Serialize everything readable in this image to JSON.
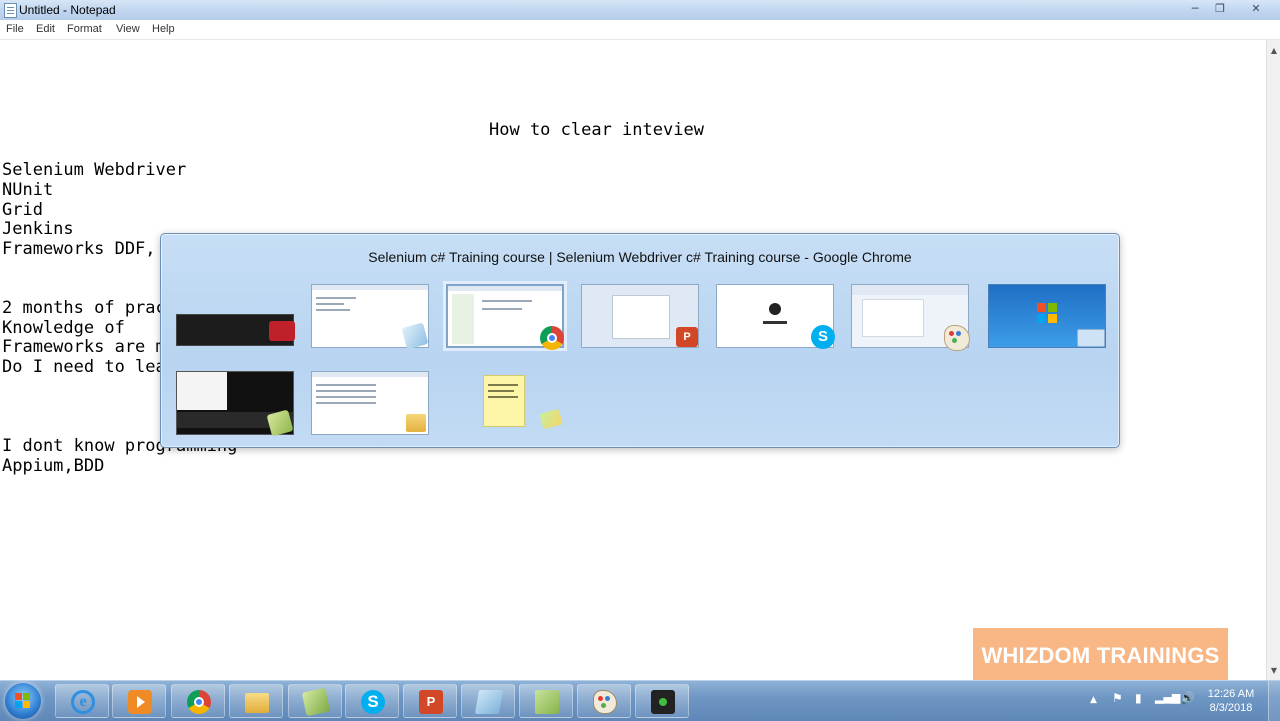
{
  "window": {
    "title": "Untitled - Notepad",
    "minimize": "─",
    "maximize": "❐",
    "close": "✕"
  },
  "menu": [
    "File",
    "Edit",
    "Format",
    "View",
    "Help"
  ],
  "document": {
    "heading": "How to clear inteview",
    "lines": [
      "Selenium Webdriver",
      "NUnit",
      "Grid",
      "Jenkins",
      "Frameworks DDF, POM, Hybrid  BDD(Specflow)",
      "",
      "",
      "2 months of practice",
      "Knowledge of",
      "Frameworks are most",
      "Do I need to learn all types of frameworks",
      "",
      "",
      "",
      "I dont know programming",
      "Appium,BDD"
    ]
  },
  "switcher": {
    "title": "Selenium c# Training course | Selenium Webdriver c# Training course - Google Chrome",
    "items": [
      {
        "app": "screen-recorder",
        "badge": "tape-icon"
      },
      {
        "app": "notepad",
        "badge": "notepad-icon"
      },
      {
        "app": "google-chrome",
        "badge": "chrome-icon",
        "selected": true
      },
      {
        "app": "powerpoint",
        "badge": "powerpoint-icon",
        "badge_text": "P"
      },
      {
        "app": "skype",
        "badge": "skype-icon",
        "badge_text": "S"
      },
      {
        "app": "paint",
        "badge": "paint-icon"
      },
      {
        "app": "desktop",
        "badge": "desktop-icon"
      },
      {
        "app": "camtasia",
        "badge": "leaf-icon"
      },
      {
        "app": "explorer",
        "badge": "folder-icon"
      },
      {
        "app": "sticky-notes",
        "badge": "sticky-notes-icon"
      }
    ]
  },
  "watermark": "WHIZDOM TRAININGS",
  "taskbar": {
    "buttons": [
      {
        "name": "internet-explorer",
        "icon": "ie-icon",
        "text": "e"
      },
      {
        "name": "media-player",
        "icon": "media-player-icon"
      },
      {
        "name": "google-chrome",
        "icon": "chrome-icon"
      },
      {
        "name": "windows-explorer",
        "icon": "folder-icon"
      },
      {
        "name": "camtasia",
        "icon": "leaf-icon"
      },
      {
        "name": "skype",
        "icon": "skype-icon",
        "text": "S"
      },
      {
        "name": "powerpoint",
        "icon": "powerpoint-icon",
        "text": "P"
      },
      {
        "name": "notepad",
        "icon": "notepad-icon"
      },
      {
        "name": "green-app",
        "icon": "green-app-icon"
      },
      {
        "name": "paint",
        "icon": "paint-icon"
      },
      {
        "name": "recorder",
        "icon": "recorder-icon"
      }
    ],
    "clock_time": "12:26 AM",
    "clock_date": "8/3/2018",
    "tray_icons": [
      "show-hidden-icon",
      "action-center-icon",
      "battery-icon",
      "network-icon",
      "volume-icon"
    ]
  },
  "colors": {
    "taskbar": "#6f97c4",
    "switcher": "#b8d4f1",
    "watermark": "#f7b179"
  }
}
